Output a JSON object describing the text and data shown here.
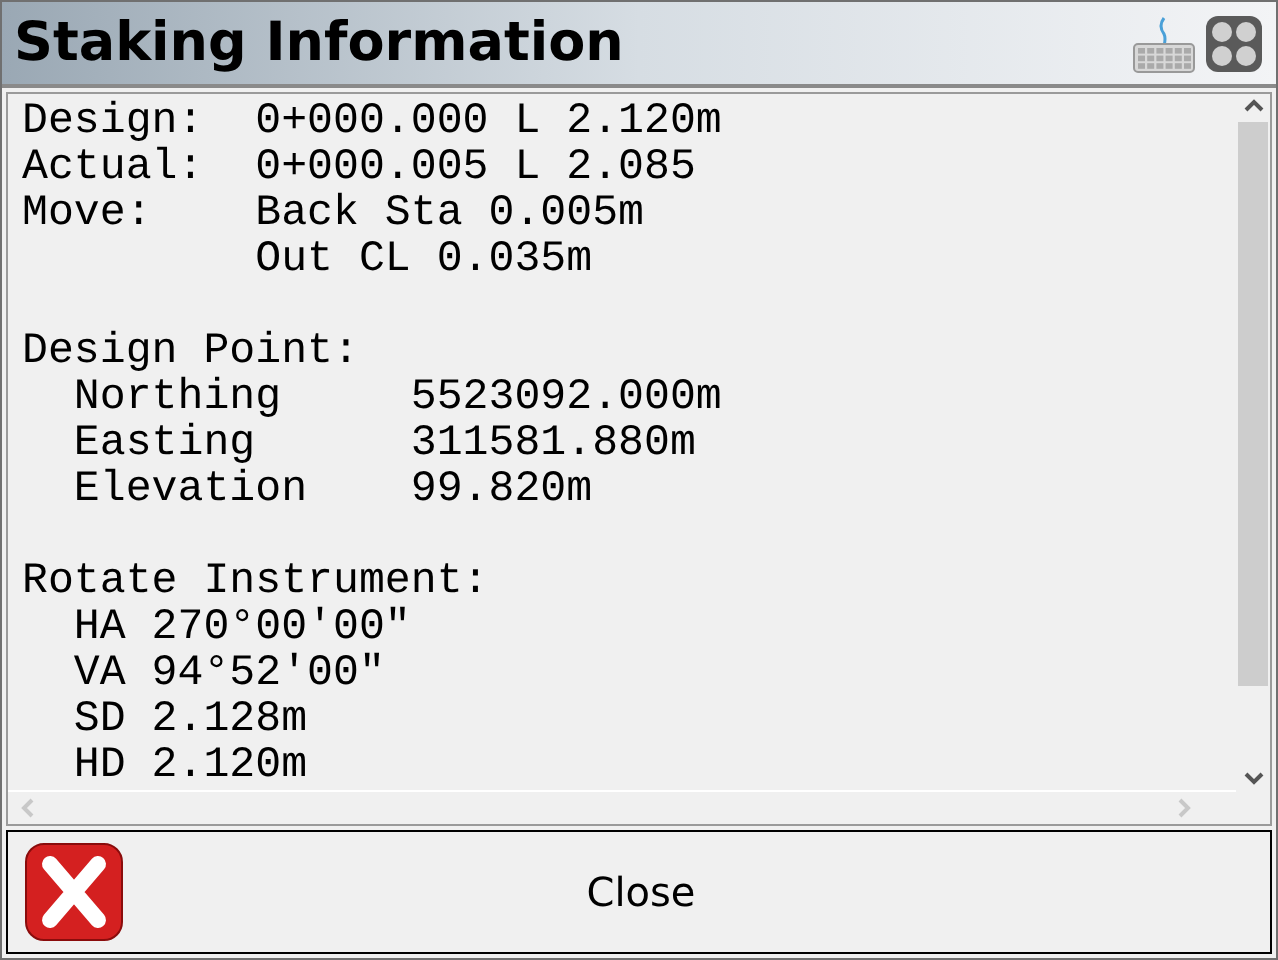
{
  "window": {
    "title": "Staking Information"
  },
  "summary": [
    {
      "label": "Design:",
      "values": [
        "0+000.000 L 2.120m"
      ]
    },
    {
      "label": "Actual:",
      "values": [
        "0+000.005 L 2.085"
      ]
    },
    {
      "label": "Move:",
      "values": [
        "Back Sta 0.005m",
        "Out CL 0.035m"
      ]
    }
  ],
  "design_point": {
    "heading": "Design Point:",
    "rows": [
      {
        "label": "Northing",
        "value": "5523092.000m"
      },
      {
        "label": "Easting",
        "value": "311581.880m"
      },
      {
        "label": "Elevation",
        "value": "99.820m"
      }
    ]
  },
  "rotate_instrument": {
    "heading": "Rotate Instrument:",
    "lines": [
      "HA 270°00'00\"",
      "VA 94°52'00\"",
      "SD 2.128m",
      "HD 2.120m"
    ]
  },
  "close_button": {
    "label": "Close"
  }
}
